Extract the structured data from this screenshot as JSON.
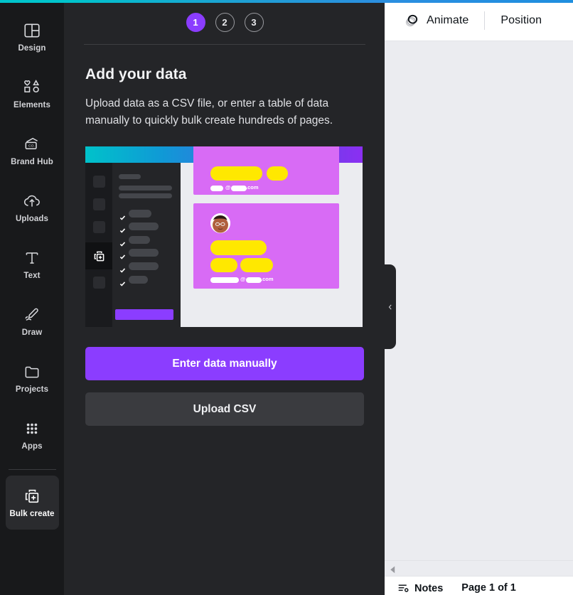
{
  "theme": {
    "accent_purple": "#8b3dff",
    "panel_bg": "#242528",
    "rail_bg": "#18191b",
    "canvas_bg": "#ebecf0",
    "top_strip_from": "#00c4cc",
    "top_strip_to": "#1f8fdf",
    "illo_card_purple": "#d86bf5",
    "illo_pill_yellow": "#ffe800"
  },
  "sidebar": {
    "items": [
      {
        "label": "Design",
        "icon": "design-layout-icon",
        "active": false
      },
      {
        "label": "Elements",
        "icon": "shapes-icon",
        "active": false
      },
      {
        "label": "Brand Hub",
        "icon": "brand-card-icon",
        "active": false
      },
      {
        "label": "Uploads",
        "icon": "cloud-upload-icon",
        "active": false
      },
      {
        "label": "Text",
        "icon": "text-t-icon",
        "active": false
      },
      {
        "label": "Draw",
        "icon": "pen-draw-icon",
        "active": false
      },
      {
        "label": "Projects",
        "icon": "folder-icon",
        "active": false
      },
      {
        "label": "Apps",
        "icon": "apps-grid-icon",
        "active": false
      }
    ],
    "footer_item": {
      "label": "Bulk create",
      "icon": "bulk-create-copy-plus-icon",
      "active": true
    }
  },
  "panel": {
    "steps": [
      {
        "number": "1",
        "state": "current"
      },
      {
        "number": "2",
        "state": "upcoming"
      },
      {
        "number": "3",
        "state": "upcoming"
      }
    ],
    "title": "Add your data",
    "description": "Upload data as a CSV file, or enter a table of data manually to quickly bulk create hundreds of pages.",
    "primary_button": "Enter data manually",
    "secondary_button": "Upload CSV",
    "illustration": {
      "name": "bulk-create-preview-illustration",
      "email_text_card1": ".com",
      "email_text_card2": ".com",
      "at_symbol": "@"
    }
  },
  "collapse_handle": {
    "icon": "chevron-left-icon"
  },
  "right_panel": {
    "header": {
      "animate_label": "Animate",
      "animate_icon": "animate-rings-icon",
      "position_label": "Position"
    },
    "hscroll": {
      "arrow_icon": "scroll-left-arrow-icon"
    },
    "bottom_bar": {
      "notes_label": "Notes",
      "notes_icon": "notes-lines-icon",
      "page_indicator": "Page 1 of 1"
    }
  }
}
